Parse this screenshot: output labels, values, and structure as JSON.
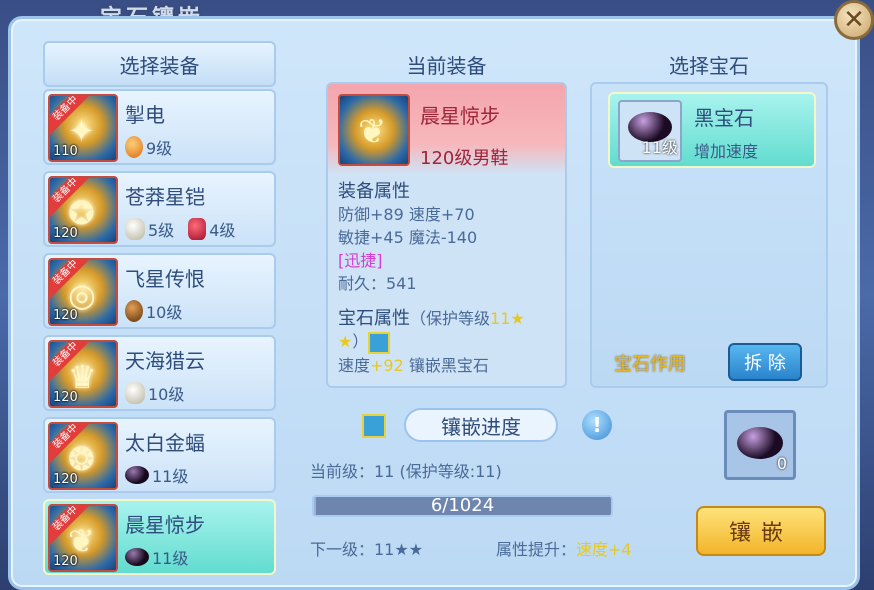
{
  "window": {
    "title": "宝石镶嵌"
  },
  "left": {
    "header": "选择装备",
    "equipped_tag": "装备中",
    "items": [
      {
        "name": "掣电",
        "level": "110",
        "gems": [
          {
            "color": "orange",
            "text": "9级"
          }
        ]
      },
      {
        "name": "苍莽星铠",
        "level": "120",
        "gems": [
          {
            "color": "white",
            "text": "5级"
          },
          {
            "color": "red",
            "text": "4级"
          }
        ]
      },
      {
        "name": "飞星传恨",
        "level": "120",
        "gems": [
          {
            "color": "brown",
            "text": "10级"
          }
        ]
      },
      {
        "name": "天海猎云",
        "level": "120",
        "gems": [
          {
            "color": "white",
            "text": "10级"
          }
        ]
      },
      {
        "name": "太白金蝠",
        "level": "120",
        "gems": [
          {
            "color": "black",
            "text": "11级"
          }
        ]
      },
      {
        "name": "晨星惊步",
        "level": "120",
        "gems": [
          {
            "color": "black",
            "text": "11级"
          }
        ],
        "selected": true
      }
    ]
  },
  "middle": {
    "header": "当前装备",
    "name": "晨星惊步",
    "subtitle": "120级男鞋",
    "attr_header": "装备属性",
    "attr_line1": "防御+89 速度+70",
    "attr_line2": "敏捷+45 魔法-140",
    "special": "[迅捷]",
    "durability": "耐久：541",
    "gem_attr_header": "宝石属性",
    "protect_text": "（保护等级",
    "protect_level": "11",
    "star": "★",
    "star2": "★",
    "paren_close": "）",
    "cut_line_a": "速度",
    "cut_line_b": "+92",
    "cut_line_c": "镶嵌黑宝石"
  },
  "progress": {
    "title": "镶嵌进度",
    "current_level": "当前级：11 (保护等级:11)",
    "value_text": "6/1024",
    "fraction": 0.006,
    "next_level": "下一级：11★★",
    "attr_up_label": "属性提升：",
    "attr_up_value": "速度+4"
  },
  "right": {
    "header": "选择宝石",
    "gem_name": "黑宝石",
    "gem_desc": "增加速度",
    "gem_level": "11级",
    "gem_effect": "宝石作用",
    "remove": "拆 除",
    "bag_count": "0",
    "inlay": "镶嵌"
  }
}
